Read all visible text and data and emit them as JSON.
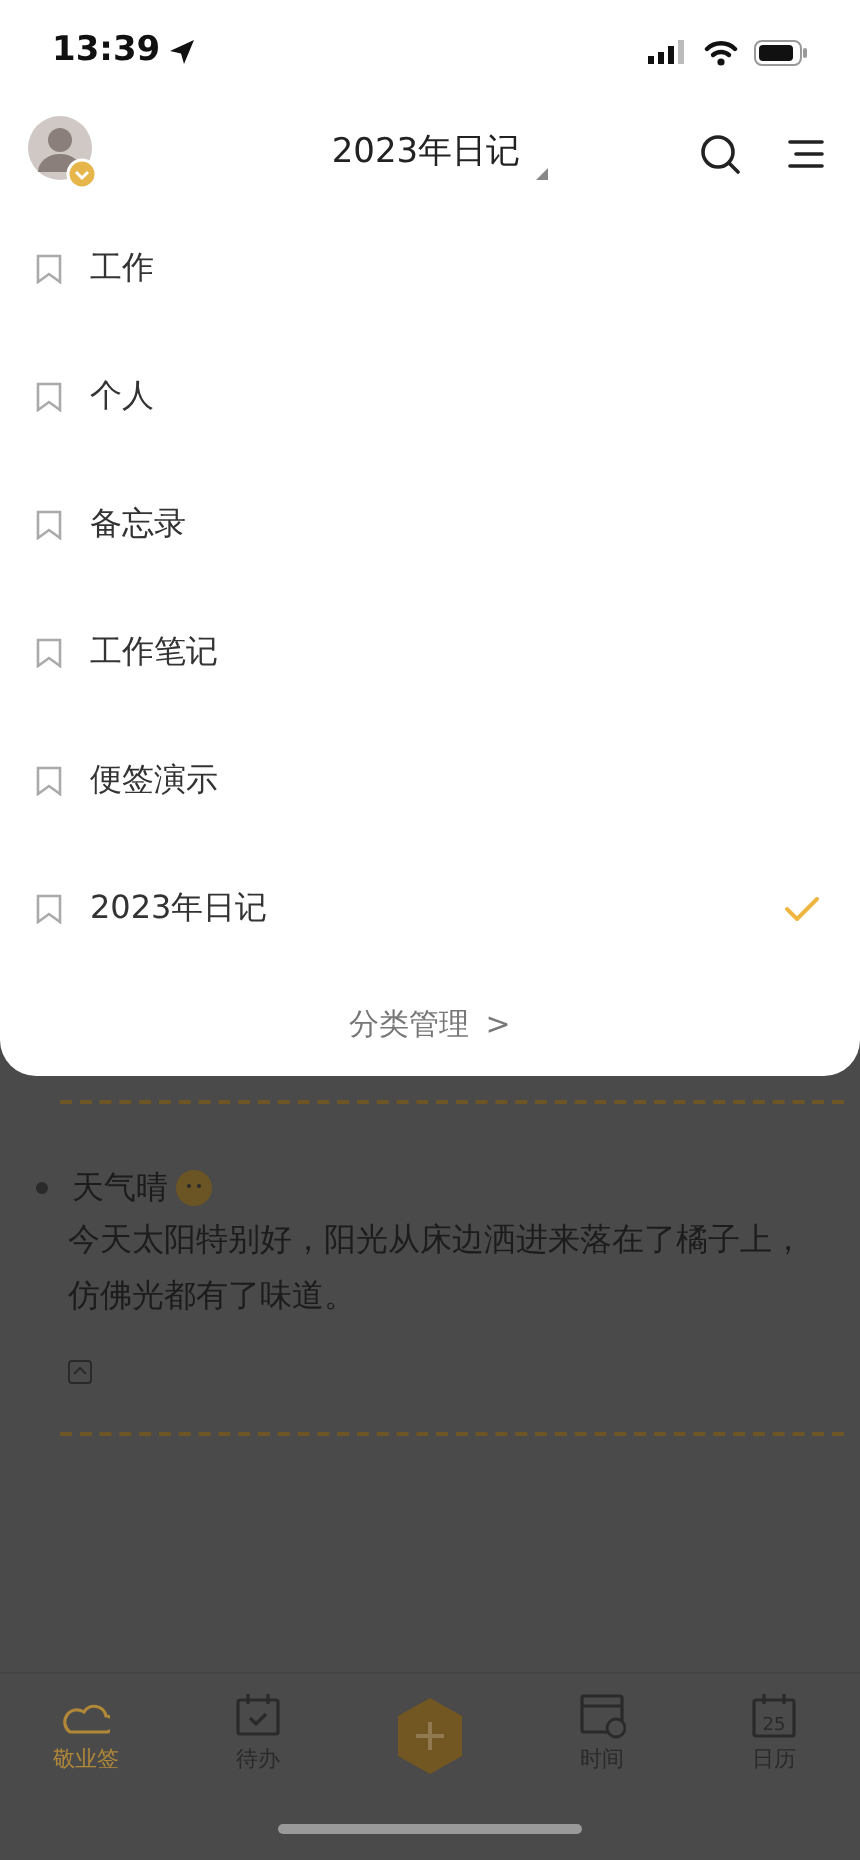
{
  "status_bar": {
    "time": "13:39"
  },
  "header": {
    "title": "2023年日记"
  },
  "categories": [
    {
      "label": "工作",
      "selected": false
    },
    {
      "label": "个人",
      "selected": false
    },
    {
      "label": "备忘录",
      "selected": false
    },
    {
      "label": "工作笔记",
      "selected": false
    },
    {
      "label": "便签演示",
      "selected": false
    },
    {
      "label": "2023年日记",
      "selected": true
    }
  ],
  "manage_link": {
    "label": "分类管理",
    "chevron": ">"
  },
  "entry": {
    "title": "天气晴",
    "body": "今天太阳特别好，阳光从床边洒进来落在了橘子上，仿佛光都有了味道。"
  },
  "tab_bar": [
    {
      "kind": "cloud",
      "label": "敬业签",
      "selected": true
    },
    {
      "kind": "todo",
      "label": "待办",
      "selected": false
    },
    {
      "kind": "add"
    },
    {
      "kind": "time",
      "label": "时间",
      "selected": false
    },
    {
      "kind": "calendar",
      "label": "日历",
      "selected": false,
      "icon_text": "25"
    }
  ]
}
